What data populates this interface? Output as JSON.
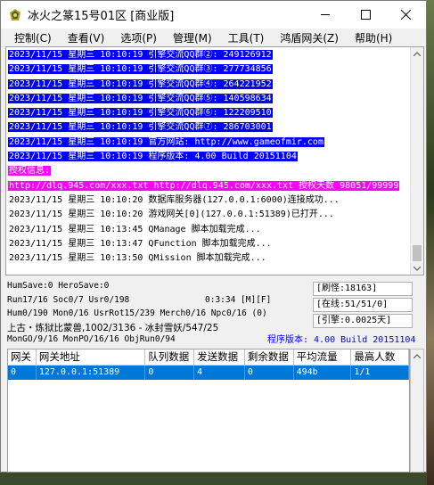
{
  "window": {
    "title": "冰火之篆15号01区 [商业版]",
    "controls": [
      "minimize-icon",
      "maximize-icon",
      "close-icon"
    ]
  },
  "menu": [
    "控制(C)",
    "查看(V)",
    "选项(P)",
    "管理(M)",
    "工具(T)",
    "鸿盾网关(Z)",
    "帮助(H)"
  ],
  "log": {
    "lines": [
      {
        "style": "sel",
        "text": "2023/11/15 星期三 10:10:19 引擎交流QQ群②: 249126912"
      },
      {
        "style": "sel",
        "text": "2023/11/15 星期三 10:10:19 引擎交流QQ群③: 277734856"
      },
      {
        "style": "sel",
        "text": "2023/11/15 星期三 10:10:19 引擎交流QQ群④: 264221952"
      },
      {
        "style": "sel",
        "text": "2023/11/15 星期三 10:10:19 引擎交流QQ群⑤: 140598634"
      },
      {
        "style": "sel",
        "text": "2023/11/15 星期三 10:10:19 引擎交流QQ群⑥: 122209510"
      },
      {
        "style": "sel",
        "text": "2023/11/15 星期三 10:10:19 引擎交流QQ群⑦: 286703001"
      },
      {
        "style": "sel",
        "text": "2023/11/15 星期三 10:10:19 官方网站: http://www.gameofmir.com"
      },
      {
        "style": "sel",
        "text": "2023/11/15 星期三 10:10:19 程序版本: 4.00 Build 20151104"
      },
      {
        "style": "pink",
        "text": "授权信息:"
      },
      {
        "style": "pink",
        "text": "http://dlq.945.com/xxx.txt http://dlq.945.com/xxx.txt 授权天数 98051/99999"
      },
      {
        "style": "norm",
        "text": "2023/11/15 星期三 10:10:20 数据库服务器(127.0.0.1:6000)连接成功..."
      },
      {
        "style": "norm",
        "text": "2023/11/15 星期三 10:10:20 游戏网关[0](127.0.0.1:51389)已打开..."
      },
      {
        "style": "norm",
        "text": "2023/11/15 星期三 10:13:45 QManage 脚本加载完成..."
      },
      {
        "style": "norm",
        "text": "2023/11/15 星期三 10:13:47 QFunction 脚本加载完成..."
      },
      {
        "style": "norm",
        "text": "2023/11/15 星期三 10:13:50 QMission 脚本加载完成..."
      }
    ]
  },
  "status": {
    "hum_save": "HumSave:0 HeroSave:0",
    "run": "Run17/16 Soc0/7 Usr0/198",
    "time": "0:3:34 [M][F]",
    "hum": "Hum0/190 Mon0/16 UsrRot15/239 Merch0/16 Npc0/16 (0)",
    "map": "上古・炼狱比蒙兽,1002/3136 - 冰封雪妖/547/25",
    "mon": "MonGO/9/16 MonPO/16/16 ObjRun0/94",
    "refresh": "[刷怪:18163]",
    "online": "[在线:51/51/0]",
    "engine": "[引擎:0.0025天]",
    "version": "程序版本: 4.00 Build 20151104"
  },
  "gate_table": {
    "headers": [
      "网关",
      "网关地址",
      "队列数据",
      "发送数据",
      "剩余数据",
      "平均流量",
      "最高人数"
    ],
    "rows": [
      [
        "0",
        "127.0.0.1:51389",
        "0",
        "4",
        "0",
        "494b",
        "1/1"
      ]
    ]
  }
}
